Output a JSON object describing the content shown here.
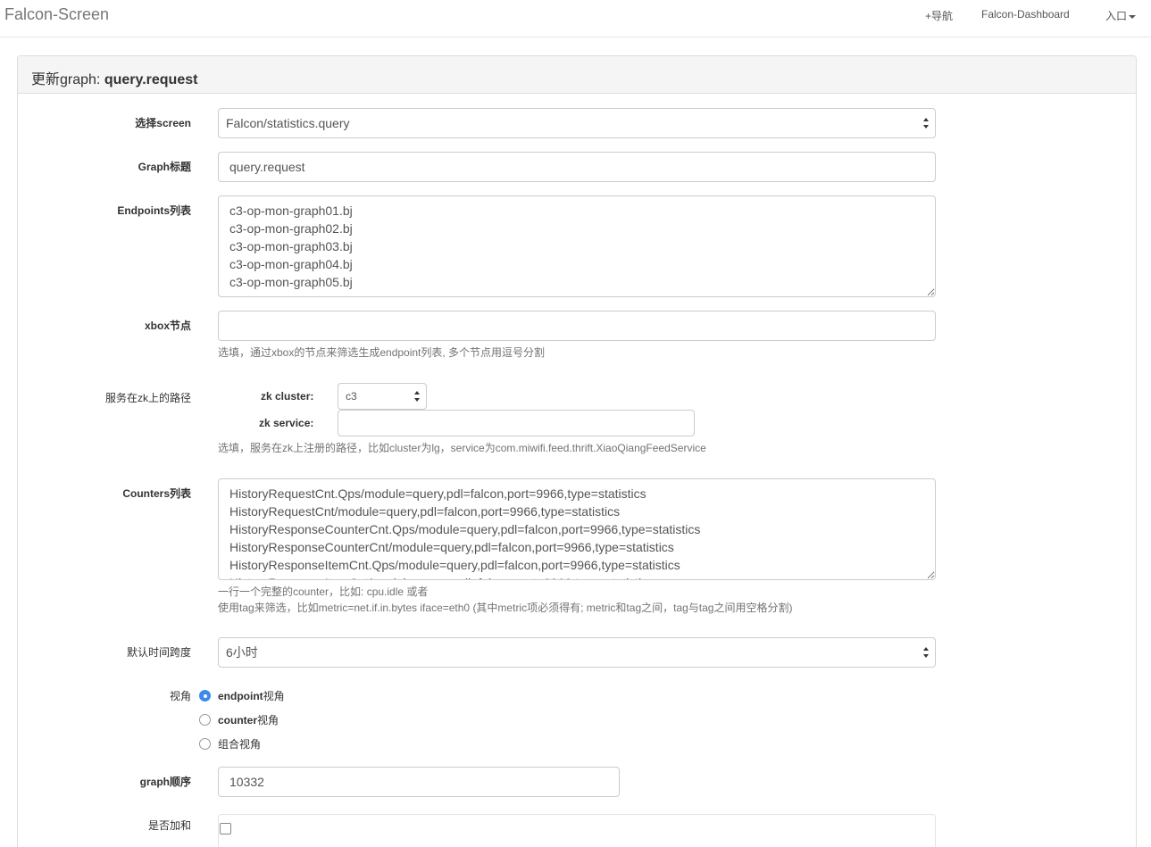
{
  "navbar": {
    "brand": "Falcon-Screen",
    "add_nav": "+导航",
    "dashboard": "Falcon-Dashboard",
    "entry": "入口"
  },
  "panel": {
    "title_prefix": "更新graph: ",
    "title_name": "query.request"
  },
  "form": {
    "screen": {
      "label": "选择screen",
      "value": "Falcon/statistics.query"
    },
    "graph_title": {
      "label": "Graph标题",
      "value": "query.request"
    },
    "endpoints": {
      "label": "Endpoints列表",
      "value": "c3-op-mon-graph01.bj\nc3-op-mon-graph02.bj\nc3-op-mon-graph03.bj\nc3-op-mon-graph04.bj\nc3-op-mon-graph05.bj"
    },
    "xbox": {
      "label": "xbox节点",
      "value": "",
      "help": "选填，通过xbox的节点来筛选生成endpoint列表, 多个节点用逗号分割"
    },
    "zk": {
      "label": "服务在zk上的路径",
      "cluster_label": "zk cluster:",
      "cluster_value": "c3",
      "service_label": "zk service:",
      "service_value": "",
      "help": "选填，服务在zk上注册的路径，比如cluster为lg，service为com.miwifi.feed.thrift.XiaoQiangFeedService"
    },
    "counters": {
      "label": "Counters列表",
      "value": "HistoryRequestCnt.Qps/module=query,pdl=falcon,port=9966,type=statistics\nHistoryRequestCnt/module=query,pdl=falcon,port=9966,type=statistics\nHistoryResponseCounterCnt.Qps/module=query,pdl=falcon,port=9966,type=statistics\nHistoryResponseCounterCnt/module=query,pdl=falcon,port=9966,type=statistics\nHistoryResponseItemCnt.Qps/module=query,pdl=falcon,port=9966,type=statistics\nHistoryResponseItemCnt/module=query,pdl=falcon,port=9966,type=statistics",
      "help_line1": "一行一个完整的counter，比如: cpu.idle 或者",
      "help_line2": "使用tag来筛选，比如metric=net.if.in.bytes iface=eth0 (其中metric项必须得有; metric和tag之间，tag与tag之间用空格分割)"
    },
    "timespan": {
      "label": "默认时间跨度",
      "value": "6小时"
    },
    "view": {
      "label": "视角",
      "options": [
        {
          "bold": "endpoint",
          "text": "视角",
          "checked": true
        },
        {
          "bold": "counter",
          "text": "视角",
          "checked": false
        },
        {
          "bold": "",
          "text": "组合视角",
          "checked": false
        }
      ]
    },
    "position": {
      "label": "graph顺序",
      "value": "10332"
    },
    "sum": {
      "label": "是否加和",
      "checked": false
    }
  },
  "colors": {
    "accent": "#3b8beb",
    "border": "#cccccc",
    "heading_bg": "#f5f5f5"
  }
}
